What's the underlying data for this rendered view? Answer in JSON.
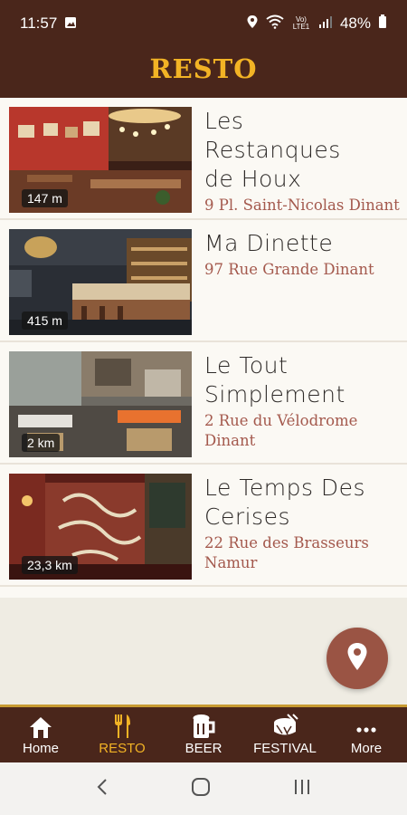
{
  "status_bar": {
    "time": "11:57",
    "battery": "48%",
    "network": "Vo) LTE1"
  },
  "header": {
    "title": "RESTO"
  },
  "restaurants": [
    {
      "name_lines": [
        "Les",
        "Restanques",
        "de Houx"
      ],
      "address": "9 Pl. Saint-Nicolas Dinant",
      "distance": "147 m"
    },
    {
      "name_lines": [
        "Ma Dinette"
      ],
      "address": "97 Rue Grande Dinant",
      "distance": "415 m"
    },
    {
      "name_lines": [
        "Le Tout",
        "Simplement"
      ],
      "address_lines": [
        "2 Rue du Vélodrome",
        "Dinant"
      ],
      "distance": "2 km"
    },
    {
      "name_lines": [
        "Le Temps Des",
        "Cerises"
      ],
      "address_lines": [
        "22 Rue des Brasseurs",
        "Namur"
      ],
      "distance": "23,3 km"
    }
  ],
  "fab": {
    "icon": "map-pin-icon"
  },
  "bottom_nav": [
    {
      "label": "Home",
      "icon": "home-icon"
    },
    {
      "label": "RESTO",
      "icon": "cutlery-icon",
      "active": true
    },
    {
      "label": "BEER",
      "icon": "beer-mug-icon"
    },
    {
      "label": "FESTIVAL",
      "icon": "drum-icon"
    },
    {
      "label": "More",
      "icon": "more-dots-icon"
    }
  ],
  "colors": {
    "primary": "#4a261b",
    "accent": "#f2b325",
    "address": "#a4594d",
    "fab": "#9a5444"
  }
}
